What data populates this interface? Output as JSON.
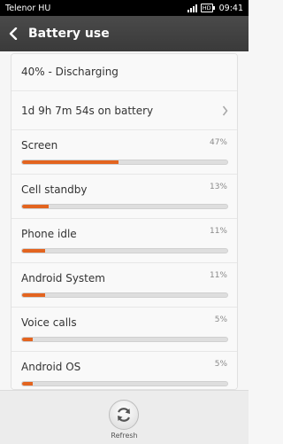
{
  "status_bar": {
    "carrier": "Telenor HU",
    "network": "HD",
    "time": "09:41"
  },
  "app_bar": {
    "title": "Battery use",
    "back_icon": "chevron-left-icon"
  },
  "summary": {
    "level": "40% - Discharging",
    "on_battery": "1d 9h 7m 54s on battery"
  },
  "usage_items": [
    {
      "name": "Screen",
      "percent_label": "47%",
      "percent": 47
    },
    {
      "name": "Cell standby",
      "percent_label": "13%",
      "percent": 13
    },
    {
      "name": "Phone idle",
      "percent_label": "11%",
      "percent": 11
    },
    {
      "name": "Android System",
      "percent_label": "11%",
      "percent": 11
    },
    {
      "name": "Voice calls",
      "percent_label": "5%",
      "percent": 5
    },
    {
      "name": "Android OS",
      "percent_label": "5%",
      "percent": 5
    }
  ],
  "bottom_bar": {
    "refresh_label": "Refresh",
    "refresh_icon": "refresh-icon"
  },
  "colors": {
    "bar_fill": "#e3641f",
    "app_bar": "#404040"
  }
}
